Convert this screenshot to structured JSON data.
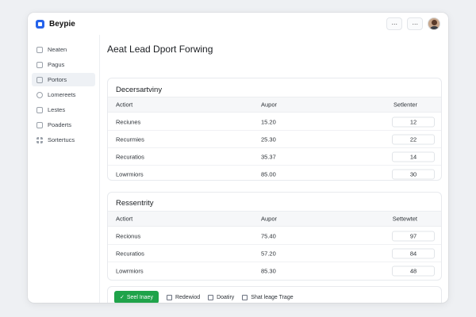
{
  "app": {
    "brand": "Beypie"
  },
  "topbar": {
    "more_a": "···",
    "more_b": "···"
  },
  "sidebar": {
    "items": [
      {
        "label": "Neaten",
        "icon": "home-icon"
      },
      {
        "label": "Pagus",
        "icon": "page-icon"
      },
      {
        "label": "Portors",
        "icon": "document-icon",
        "active": true
      },
      {
        "label": "Lomereets",
        "icon": "circle-icon"
      },
      {
        "label": "Lestes",
        "icon": "page-icon"
      },
      {
        "label": "Poaderts",
        "icon": "document-icon"
      },
      {
        "label": "Sortertucs",
        "icon": "grid-icon"
      }
    ]
  },
  "main": {
    "title": "Aeat Lead Dport Forwing",
    "card1": {
      "title": "Decersartviny",
      "columns": [
        "Actiort",
        "Aupor",
        "Setlenter"
      ],
      "rows": [
        {
          "name": "Reciunes",
          "value": "15.20",
          "qty": "12"
        },
        {
          "name": "Recurmies",
          "value": "25.30",
          "qty": "22"
        },
        {
          "name": "Recuratios",
          "value": "35.37",
          "qty": "14"
        },
        {
          "name": "Lowrmiors",
          "value": "85.00",
          "qty": "30"
        }
      ]
    },
    "card2": {
      "title": "Ressentrity",
      "columns": [
        "Actiort",
        "Aupor",
        "Settewtet"
      ],
      "rows": [
        {
          "name": "Recionus",
          "value": "75.40",
          "qty": "97"
        },
        {
          "name": "Recuratios",
          "value": "57.20",
          "qty": "84"
        },
        {
          "name": "Lowrmiors",
          "value": "85.30",
          "qty": "48"
        }
      ]
    },
    "footer": {
      "primary": "Seel Inaey",
      "primary_check": "✓",
      "actions": [
        "Redewiod",
        "Doatiry",
        "Shat leage Trage"
      ]
    }
  },
  "colors": {
    "accent": "#1fa34a",
    "brand": "#2563eb"
  }
}
